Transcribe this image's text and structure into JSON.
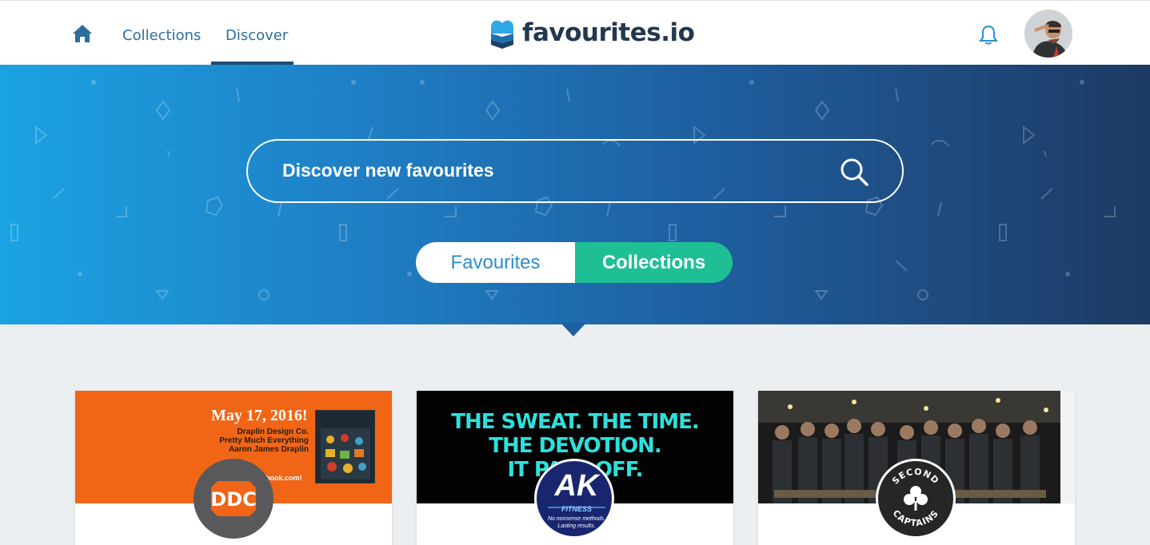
{
  "header": {
    "nav": [
      {
        "label": "Collections"
      },
      {
        "label": "Discover",
        "active": true
      }
    ],
    "logo_text": "favourites.io",
    "icons": {
      "home": "home-icon",
      "bell": "bell-icon",
      "avatar": "user-avatar"
    }
  },
  "hero": {
    "search_placeholder": "Discover new favourites",
    "toggle": {
      "favourites": "Favourites",
      "collections": "Collections",
      "selected": "Collections"
    }
  },
  "cards": [
    {
      "image_title": "May 17, 2016!",
      "image_lines": [
        "Draplin Design Co.",
        "Pretty Much Everything",
        "Aaron James Draplin"
      ],
      "image_site": "book.com!",
      "badge_text": "DDC"
    },
    {
      "image_lines": [
        "THE SWEAT. THE TIME.",
        "THE DEVOTION.",
        "IT PAYS OFF."
      ],
      "badge_text": "AK",
      "badge_sub": "FITNESS",
      "badge_small": "No nonsense methods. Lasting results."
    },
    {
      "badge_text_top": "SECOND",
      "badge_text_bottom": "CAPTAINS"
    }
  ],
  "colors": {
    "brand_dark": "#23374f",
    "accent_green": "#1fbf95",
    "nav_blue": "#2d6d9e"
  }
}
